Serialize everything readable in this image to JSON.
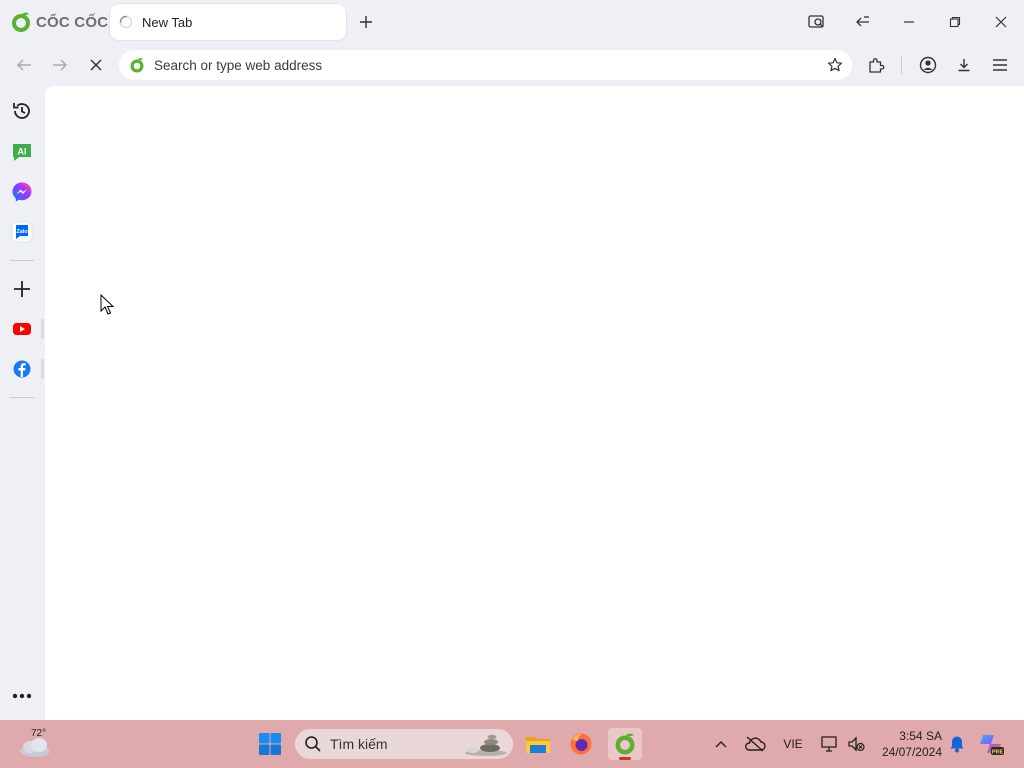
{
  "browser": {
    "brand": "CỐC CỐC",
    "tab": {
      "title": "New Tab",
      "status": "loading"
    },
    "omnibox": {
      "placeholder": "Search or type web address",
      "value": ""
    },
    "page_loading": true
  },
  "sidebar": {
    "items": [
      {
        "name": "history",
        "icon": "history-icon"
      },
      {
        "name": "ai-chat",
        "icon": "ai-chat-icon",
        "label": "AI"
      },
      {
        "name": "messenger",
        "icon": "messenger-icon"
      },
      {
        "name": "zalo",
        "icon": "zalo-icon",
        "label": "Zalo"
      },
      {
        "name": "add",
        "icon": "plus-icon"
      },
      {
        "name": "youtube",
        "icon": "youtube-icon"
      },
      {
        "name": "facebook",
        "icon": "facebook-icon"
      },
      {
        "name": "more",
        "icon": "more-dots-icon"
      }
    ]
  },
  "taskbar": {
    "weather": {
      "temp": "72°"
    },
    "search_label": "Tìm kiếm",
    "apps": [
      "start-icon",
      "file-explorer-icon",
      "firefox-icon",
      "coccoc-icon"
    ],
    "language": "VIE",
    "clock": {
      "time": "3:54 SA",
      "date": "24/07/2024"
    },
    "copilot_badge": "PRE"
  },
  "colors": {
    "chrome_bg": "#eef0f5",
    "taskbar_bg": "#e0a9ab",
    "brand_green": "#5ab031",
    "youtube_red": "#ff0000",
    "facebook_blue": "#1877f2"
  }
}
